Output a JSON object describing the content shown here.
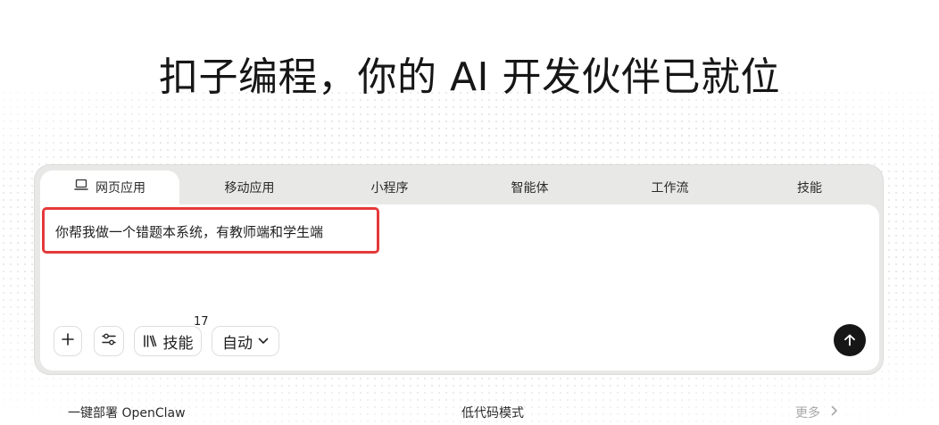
{
  "headline": "扣子编程，你的 AI 开发伙伴已就位",
  "tabs": [
    {
      "label": "网页应用",
      "icon": "laptop-icon",
      "active": true
    },
    {
      "label": "移动应用"
    },
    {
      "label": "小程序"
    },
    {
      "label": "智能体"
    },
    {
      "label": "工作流"
    },
    {
      "label": "技能"
    }
  ],
  "prompt": {
    "text": "你帮我做一个错题本系统，有教师端和学生端"
  },
  "toolbar": {
    "add_icon": "plus-icon",
    "settings_icon": "sliders-icon",
    "skills_label": "技能",
    "skills_icon": "books-icon",
    "skills_count": "17",
    "mode_label": "自动",
    "mode_icon": "chevron-down-icon",
    "send_icon": "arrow-up-icon"
  },
  "bottom": {
    "left": "一键部署 OpenClaw",
    "center": "低代码模式",
    "more": "更多"
  },
  "colors": {
    "highlight": "#e5393b",
    "send": "#161616"
  }
}
